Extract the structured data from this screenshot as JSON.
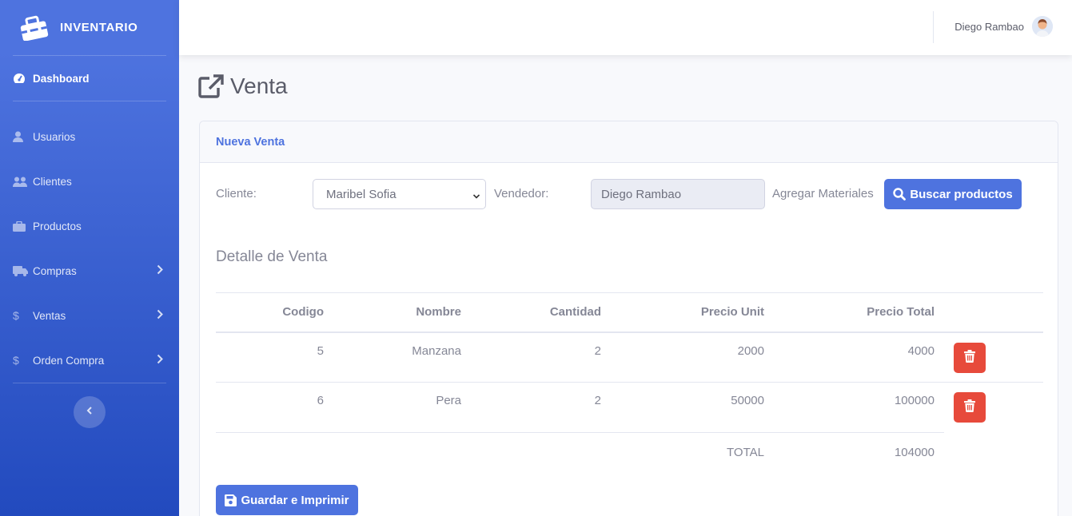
{
  "brand": {
    "name": "INVENTARIO",
    "icon": "toolbox-icon"
  },
  "sidebar": {
    "items": [
      {
        "label": "Dashboard",
        "icon": "tachometer-icon"
      },
      {
        "label": "Usuarios",
        "icon": "user-icon"
      },
      {
        "label": "Clientes",
        "icon": "users-icon"
      },
      {
        "label": "Productos",
        "icon": "briefcase-icon"
      },
      {
        "label": "Compras",
        "icon": "truck-icon",
        "has_submenu": true
      },
      {
        "label": "Ventas",
        "icon": "dollar-icon",
        "has_submenu": true
      },
      {
        "label": "Orden Compra",
        "icon": "dollar-icon",
        "has_submenu": true
      }
    ]
  },
  "topbar": {
    "user_name": "Diego Rambao"
  },
  "page": {
    "title": "Venta",
    "icon": "external-link-icon"
  },
  "card": {
    "header": "Nueva Venta",
    "form": {
      "cliente_label": "Cliente:",
      "cliente_value": "Maribel Sofia",
      "vendedor_label": "Vendedor:",
      "vendedor_value": "Diego Rambao",
      "agregar_label": "Agregar Materiales",
      "buscar_button": "Buscar productos"
    },
    "detalle_title": "Detalle de Venta",
    "table": {
      "headers": [
        "Codigo",
        "Nombre",
        "Cantidad",
        "Precio Unit",
        "Precio Total"
      ],
      "rows": [
        [
          "5",
          "Manzana",
          "2",
          "2000",
          "4000"
        ],
        [
          "6",
          "Pera",
          "2",
          "50000",
          "100000"
        ]
      ],
      "total_label": "TOTAL",
      "total_value": "104000"
    },
    "save_button": "Guardar e Imprimir"
  },
  "colors": {
    "primary": "#4e73df",
    "danger": "#e74a3b",
    "sidebar_end": "#224abe"
  }
}
